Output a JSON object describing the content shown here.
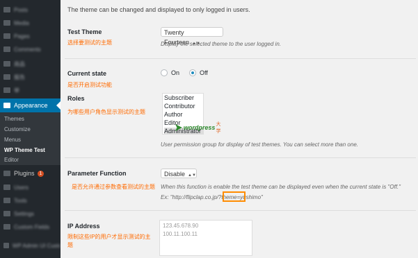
{
  "sidebar": {
    "blurred_items": [
      "Posts",
      "Media",
      "Pages",
      "Comments",
      "商品",
      "报告",
      "举"
    ],
    "appearance_label": "Appearance",
    "submenu": [
      "Themes",
      "Customize",
      "Menus",
      "WP Theme Test",
      "Editor"
    ],
    "plugins_label": "Plugins",
    "plugins_badge": "1",
    "blurred_items_lower": [
      "Users",
      "Tools",
      "Settings",
      "Custom Fields",
      "WP Admin UI Customize"
    ]
  },
  "main": {
    "intro": "The theme can be changed and displayed to only logged in users.",
    "test_theme": {
      "label": "Test Theme",
      "note_cn": "选择要测试的主题",
      "value": "Twenty Fourteen",
      "desc": "Display the selected theme to the user logged in."
    },
    "current_state": {
      "label": "Current state",
      "note_cn": "是否开启测试功能",
      "on_label": "On",
      "off_label": "Off",
      "selected": "off"
    },
    "roles": {
      "label": "Roles",
      "note_cn": "为哪些用户角色显示测试的主题",
      "options": [
        "Subscriber",
        "Contributor",
        "Author",
        "Editor",
        "Administrator"
      ],
      "selected": "Administrator",
      "desc": "User permission group for display of test themes. You can select more than one."
    },
    "parameter_function": {
      "label": "Parameter Function",
      "note_cn": "是否允许通过参数查看测试的主题",
      "value": "Disable",
      "desc_line1": "When this function is enable the test theme can be displayed even when the current state is \"Off.\"",
      "desc_line2": "Ex: \"http://flipclap.co.jp/?theme=yushimo\""
    },
    "ip_address": {
      "label": "IP Address",
      "note_cn": "限制这些IP的用户才显示测试的主题",
      "values": [
        "123.45.678.90",
        "100.11.100.11"
      ]
    },
    "watermark": {
      "text": "wordpress",
      "cn": "大学"
    }
  },
  "colors": {
    "accent": "#0073aa",
    "annotation": "#ff6a00",
    "sidebar_bg": "#23282d"
  }
}
